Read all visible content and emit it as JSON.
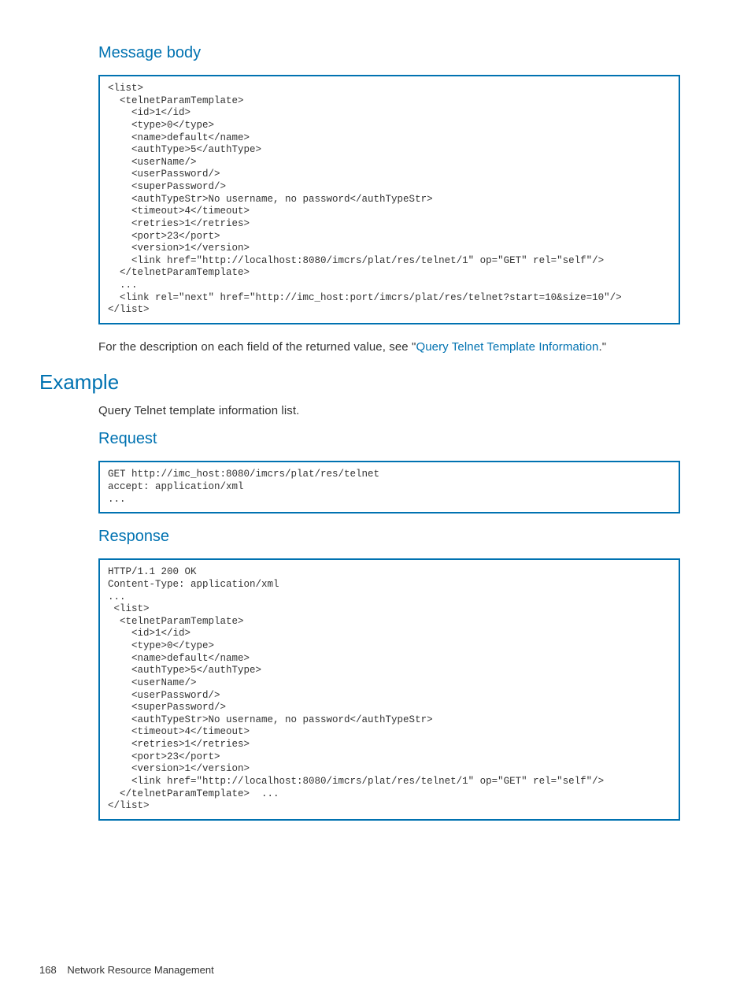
{
  "headings": {
    "message_body": "Message body",
    "example": "Example",
    "request": "Request",
    "response": "Response"
  },
  "code": {
    "message_body": "<list>\n  <telnetParamTemplate>\n    <id>1</id>\n    <type>0</type>\n    <name>default</name>\n    <authType>5</authType>\n    <userName/>\n    <userPassword/>\n    <superPassword/>\n    <authTypeStr>No username, no password</authTypeStr>\n    <timeout>4</timeout>\n    <retries>1</retries>\n    <port>23</port>\n    <version>1</version>\n    <link href=\"http://localhost:8080/imcrs/plat/res/telnet/1\" op=\"GET\" rel=\"self\"/>\n  </telnetParamTemplate>\n  ...\n  <link rel=\"next\" href=\"http://imc_host:port/imcrs/plat/res/telnet?start=10&size=10\"/>\n</list>",
    "request": "GET http://imc_host:8080/imcrs/plat/res/telnet\naccept: application/xml\n...",
    "response": "HTTP/1.1 200 OK\nContent-Type: application/xml\n...\n <list>\n  <telnetParamTemplate>\n    <id>1</id>\n    <type>0</type>\n    <name>default</name>\n    <authType>5</authType>\n    <userName/>\n    <userPassword/>\n    <superPassword/>\n    <authTypeStr>No username, no password</authTypeStr>\n    <timeout>4</timeout>\n    <retries>1</retries>\n    <port>23</port>\n    <version>1</version>\n    <link href=\"http://localhost:8080/imcrs/plat/res/telnet/1\" op=\"GET\" rel=\"self\"/>\n  </telnetParamTemplate>  ...\n</list>"
  },
  "paragraphs": {
    "field_desc_prefix": "For the description on each field of the returned value, see \"",
    "field_desc_link": "Query Telnet Template Information",
    "field_desc_suffix": ".\"",
    "example_intro": "Query Telnet template information list."
  },
  "footer": {
    "page_number": "168",
    "chapter": "Network Resource Management"
  }
}
